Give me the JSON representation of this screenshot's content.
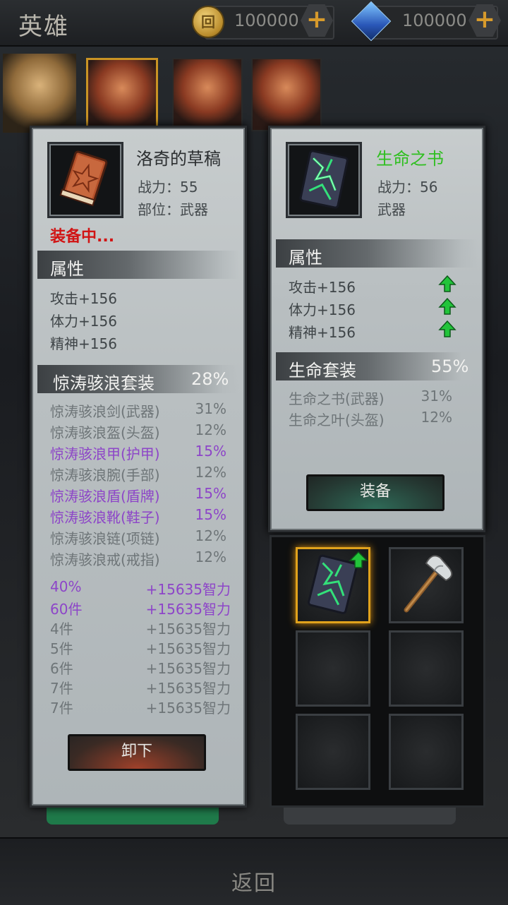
{
  "header": {
    "title": "英雄",
    "gold": "100000",
    "gems": "100000",
    "gold_icon_glyph": "回"
  },
  "left_panel": {
    "item_name": "洛奇的草稿",
    "power": "战力：55",
    "slot": "部位：武器",
    "status": "装备中...",
    "attr_header": "属性",
    "attrs": [
      "攻击+156",
      "体力+156",
      "精神+156"
    ],
    "set_name": "惊涛骇浪套装",
    "set_pct": "28%",
    "set_items": [
      {
        "name": "惊涛骇浪剑(武器)",
        "pct": "31%",
        "style": "gray"
      },
      {
        "name": "惊涛骇浪盔(头盔)",
        "pct": "12%",
        "style": "gray"
      },
      {
        "name": "惊涛骇浪甲(护甲)",
        "pct": "15%",
        "style": "purple"
      },
      {
        "name": "惊涛骇浪腕(手部)",
        "pct": "12%",
        "style": "gray"
      },
      {
        "name": "惊涛骇浪盾(盾牌)",
        "pct": "15%",
        "style": "purple"
      },
      {
        "name": "惊涛骇浪靴(鞋子)",
        "pct": "15%",
        "style": "purple"
      },
      {
        "name": "惊涛骇浪链(项链)",
        "pct": "12%",
        "style": "gray"
      },
      {
        "name": "惊涛骇浪戒(戒指)",
        "pct": "12%",
        "style": "gray"
      }
    ],
    "bonuses": [
      {
        "req": "40%",
        "val": "+15635智力",
        "style": "purple"
      },
      {
        "req": "60件",
        "val": "+15635智力",
        "style": "purple"
      },
      {
        "req": "4件",
        "val": "+15635智力",
        "style": "gray"
      },
      {
        "req": "5件",
        "val": "+15635智力",
        "style": "gray"
      },
      {
        "req": "6件",
        "val": "+15635智力",
        "style": "gray"
      },
      {
        "req": "7件",
        "val": "+15635智力",
        "style": "gray"
      },
      {
        "req": "7件",
        "val": "+15635智力",
        "style": "gray"
      }
    ],
    "button_label": "卸下"
  },
  "right_panel": {
    "item_name": "生命之书",
    "name_color": "#2fbf1f",
    "power": "战力：56",
    "slot": "武器",
    "attr_header": "属性",
    "attrs": [
      "攻击+156",
      "体力+156",
      "精神+156"
    ],
    "set_name": "生命套装",
    "set_pct": "55%",
    "set_items": [
      {
        "name": "生命之书(武器)",
        "pct": "31%"
      },
      {
        "name": "生命之叶(头盔)",
        "pct": "12%"
      }
    ],
    "button_label": "装备"
  },
  "inventory": {
    "slots": [
      "green-book-icon",
      "axe-icon",
      "",
      "",
      "",
      ""
    ]
  },
  "footer": {
    "back_label": "返回"
  },
  "colors": {
    "purple": "#8d45c8",
    "red": "#d11414",
    "green_arrow": "#22c43a",
    "gold_frame": "#e0a21c"
  }
}
